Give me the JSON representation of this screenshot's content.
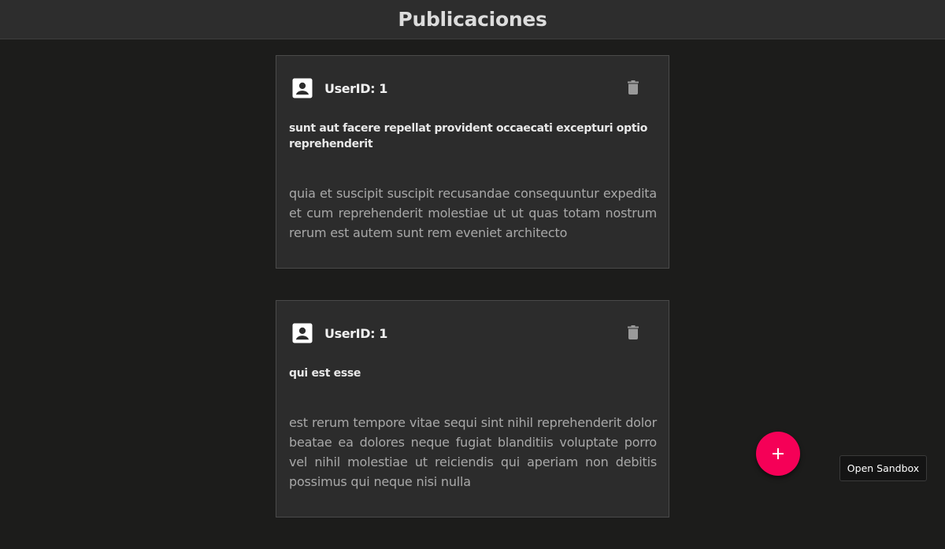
{
  "header": {
    "title": "Publicaciones"
  },
  "posts": [
    {
      "user_label": "UserID: 1",
      "title": "sunt aut facere repellat provident occaecati excepturi optio reprehenderit",
      "body": "quia et suscipit suscipit recusandae consequuntur expedita et cum reprehenderit molestiae ut ut quas totam nostrum rerum est autem sunt rem eveniet architecto"
    },
    {
      "user_label": "UserID: 1",
      "title": "qui est esse",
      "body": "est rerum tempore vitae sequi sint nihil reprehenderit dolor beatae ea dolores neque fugiat blanditiis voluptate porro vel nihil molestiae ut reiciendis qui aperiam non debitis possimus qui neque nisi nulla"
    }
  ],
  "fab": {
    "icon": "plus-icon",
    "color": "#f50057"
  },
  "sandbox": {
    "label": "Open Sandbox"
  },
  "icons": {
    "user": "account-box-icon",
    "delete": "trash-icon"
  }
}
